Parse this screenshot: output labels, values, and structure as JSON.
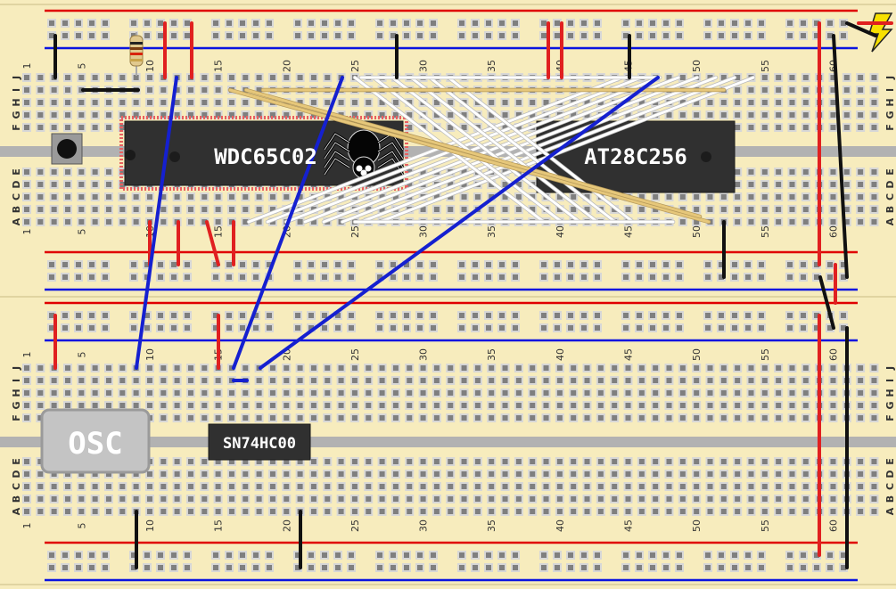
{
  "colors": {
    "board": "#f7ecbd",
    "hole": "#7f7f7f",
    "hole_frame": "#d7d7d7",
    "rail_red": "#e00000",
    "rail_blue": "#0a14e0",
    "gutter": "#b2b2b2",
    "wire_red": "#e02020",
    "wire_black": "#111111",
    "wire_blue": "#1520d0",
    "wire_white": "#ffffff",
    "wire_tan": "#e6c77a",
    "chip": "#303030",
    "chip_text": "#ffffff",
    "osc_body": "#c4c4c4",
    "highlight": "#e86060",
    "power_icon": "#f7e000"
  },
  "column_numbers": [
    "1",
    "5",
    "10",
    "15",
    "20",
    "25",
    "30",
    "35",
    "40",
    "45",
    "50",
    "55",
    "60"
  ],
  "row_letters_top": [
    "J",
    "I",
    "H",
    "G",
    "F"
  ],
  "row_letters_bottom": [
    "E",
    "D",
    "C",
    "B",
    "A"
  ],
  "chips": {
    "cpu": {
      "label": "WDC65C02"
    },
    "rom": {
      "label": "AT28C256"
    },
    "nand": {
      "label": "SN74HC00"
    },
    "oscillator": {
      "label": "OSC"
    }
  },
  "icons": {
    "spider": "spider-icon",
    "power": "lightning-power-icon",
    "button": "push-button-icon",
    "resistor": "resistor-icon"
  }
}
